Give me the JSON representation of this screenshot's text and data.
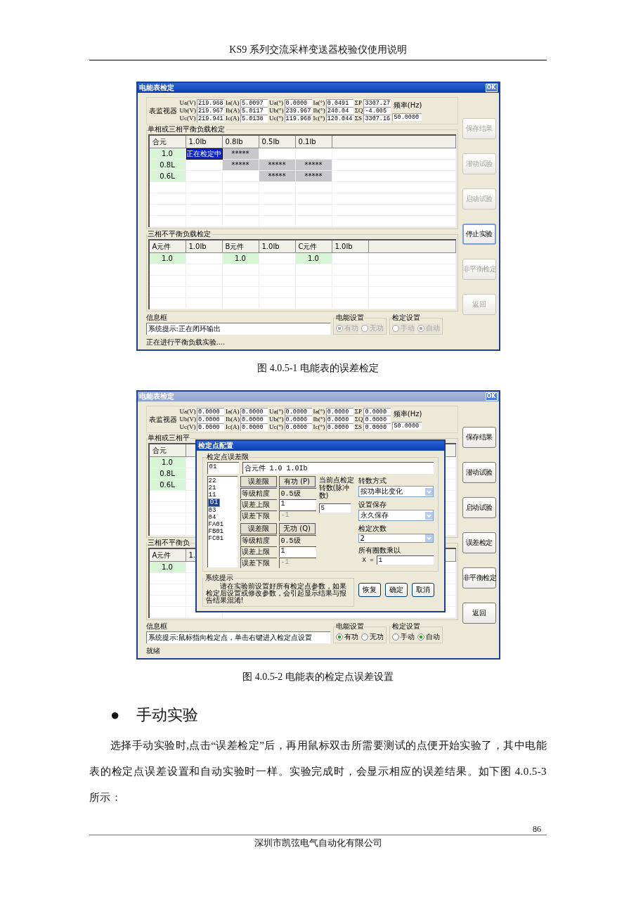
{
  "header": {
    "title": "KS9 系列交流采样变送器校验仪使用说明"
  },
  "figures": [
    {
      "window": {
        "title": "电能表检定",
        "active": true,
        "close_label": "OK",
        "monitor": {
          "label": "表监视器",
          "groups": [
            {
              "labels": [
                "Ua(V)",
                "Ub(V)",
                "Uc(V)"
              ],
              "values": [
                "219.968",
                "219.967",
                "219.941"
              ]
            },
            {
              "labels": [
                "Ia(A)",
                "Ib(A)",
                "Ic(A)"
              ],
              "values": [
                "5.0097",
                "5.0117",
                "5.0138"
              ]
            },
            {
              "labels": [
                "Ua(°)",
                "Ub(°)",
                "Uc(°)"
              ],
              "values": [
                "0.0000",
                "239.967",
                "119.968"
              ]
            },
            {
              "labels": [
                "Ia(°)",
                "Ib(°)",
                "Ic(°)"
              ],
              "values": [
                "0.0491",
                "240.04",
                "120.044"
              ]
            },
            {
              "labels": [
                "ΣP",
                "ΣQ",
                "ΣS"
              ],
              "values": [
                "3307.27",
                "-4.005",
                "3307.16"
              ]
            }
          ],
          "frequency": {
            "label": "频率(Hz)",
            "value": "50.0000"
          }
        },
        "balanced": {
          "title": "单相或三相平衡负载检定",
          "columns": [
            "合元",
            "1.0Ib",
            "0.8Ib",
            "0.5Ib",
            "0.1Ib"
          ],
          "rows": [
            {
              "cells": [
                {
                  "text": "1.0",
                  "kind": "label"
                },
                {
                  "text": "正在检定中",
                  "kind": "testing"
                },
                {
                  "text": "*****",
                  "kind": "queued"
                },
                {
                  "kind": "empty"
                },
                {
                  "kind": "empty"
                }
              ]
            },
            {
              "cells": [
                {
                  "text": "0.8L",
                  "kind": "label"
                },
                {
                  "kind": "empty"
                },
                {
                  "text": "*****",
                  "kind": "queued"
                },
                {
                  "text": "*****",
                  "kind": "queued"
                },
                {
                  "text": "*****",
                  "kind": "queued"
                }
              ]
            },
            {
              "cells": [
                {
                  "text": "0.6L",
                  "kind": "label"
                },
                {
                  "kind": "empty"
                },
                {
                  "kind": "empty"
                },
                {
                  "text": "*****",
                  "kind": "queued"
                },
                {
                  "text": "*****",
                  "kind": "queued"
                }
              ]
            }
          ]
        },
        "unbalanced": {
          "title": "三相不平衡负载检定",
          "columns": [
            "A元件",
            "1.0Ib",
            "B元件",
            "1.0Ib",
            "C元件",
            "1.0Ib"
          ],
          "rows": [
            {
              "cells": [
                {
                  "text": "1.0",
                  "kind": "label"
                },
                {
                  "kind": "empty"
                },
                {
                  "text": "1.0",
                  "kind": "label"
                },
                {
                  "kind": "empty"
                },
                {
                  "text": "1.0",
                  "kind": "label"
                },
                {
                  "kind": "empty"
                }
              ]
            }
          ]
        },
        "buttons": [
          {
            "label": "保存结果",
            "disabled": true,
            "focused": false
          },
          {
            "label": "潜动试验",
            "disabled": true,
            "focused": false
          },
          {
            "label": "启动试验",
            "disabled": true,
            "focused": false
          },
          {
            "label": "停止实验",
            "disabled": false,
            "focused": true
          },
          {
            "label": "非平衡检定",
            "disabled": true,
            "focused": false
          },
          {
            "label": "返回",
            "disabled": true,
            "focused": false
          }
        ],
        "info": {
          "label": "信息框",
          "message": "系统提示:正在闭环输出"
        },
        "energy": {
          "title": "电能设置",
          "disabled": true,
          "options": [
            {
              "label": "有功",
              "selected": true
            },
            {
              "label": "无功",
              "selected": false
            }
          ]
        },
        "mode": {
          "title": "检定设置",
          "disabled": true,
          "options": [
            {
              "label": "手动",
              "selected": false
            },
            {
              "label": "自动",
              "selected": true
            }
          ]
        },
        "status": "正在进行平衡负载实验...."
      },
      "caption": "图 4.0.5-1 电能表的误差检定"
    },
    {
      "window": {
        "title": "电能表检定",
        "active": false,
        "close_label": "OK",
        "monitor": {
          "label": "表监视器",
          "groups": [
            {
              "labels": [
                "Ua(V)",
                "Ub(V)",
                "Uc(V)"
              ],
              "values": [
                "0.0000",
                "0.0000",
                "0.0000"
              ]
            },
            {
              "labels": [
                "Ia(A)",
                "Ib(A)",
                "Ic(A)"
              ],
              "values": [
                "0.0000",
                "0.0000",
                "0.0000"
              ]
            },
            {
              "labels": [
                "Ua(°)",
                "Ub(°)",
                "Uc(°)"
              ],
              "values": [
                "0.0000",
                "0.0000",
                "0.0000"
              ]
            },
            {
              "labels": [
                "Ia(°)",
                "Ib(°)",
                "Ic(°)"
              ],
              "values": [
                "0.0000",
                "0.0000",
                "0.0000"
              ]
            },
            {
              "labels": [
                "ΣP",
                "ΣQ",
                "ΣS"
              ],
              "values": [
                "0.0000",
                "0.0000",
                "0.0000"
              ]
            }
          ],
          "frequency": {
            "label": "频率(Hz)",
            "value": "50.0000"
          }
        },
        "balanced": {
          "title": "单相或三相平",
          "columns": [
            "合元"
          ],
          "rows": [
            {
              "cells": [
                {
                  "text": "1.0",
                  "kind": "label"
                }
              ]
            },
            {
              "cells": [
                {
                  "text": "0.8L",
                  "kind": "label"
                }
              ]
            },
            {
              "cells": [
                {
                  "text": "0.6L",
                  "kind": "label"
                }
              ]
            }
          ]
        },
        "unbalanced": {
          "title": "三相不平衡负",
          "columns": [
            "A元件",
            "1."
          ],
          "rows": [
            {
              "cells": [
                {
                  "text": "1.0",
                  "kind": "label"
                }
              ]
            }
          ]
        },
        "buttons": [
          {
            "label": "保存结果",
            "disabled": false,
            "focused": false
          },
          {
            "label": "潜动试验",
            "disabled": false,
            "focused": false
          },
          {
            "label": "启动试验",
            "disabled": false,
            "focused": false
          },
          {
            "label": "误差检定",
            "disabled": false,
            "focused": false
          },
          {
            "label": "非平衡检定",
            "disabled": false,
            "focused": false
          },
          {
            "label": "返回",
            "disabled": false,
            "focused": false
          }
        ],
        "info": {
          "label": "信息框",
          "message": "系统提示:鼠标指向检定点，单击右键进入检定点设置"
        },
        "energy": {
          "title": "电能设置",
          "disabled": false,
          "options": [
            {
              "label": "有功",
              "selected": true
            },
            {
              "label": "无功",
              "selected": false
            }
          ]
        },
        "mode": {
          "title": "检定设置",
          "disabled": false,
          "options": [
            {
              "label": "手动",
              "selected": false
            },
            {
              "label": "自动",
              "selected": true
            }
          ]
        },
        "status": "就绪",
        "dialog": {
          "title": "检定点配置",
          "group_title": "检定点误差限",
          "code": "01",
          "description": "合元件 1.0 1.0Ib",
          "points": [
            {
              "label": "22",
              "selected": false
            },
            {
              "label": "21",
              "selected": false
            },
            {
              "label": "11",
              "selected": false
            },
            {
              "label": "01",
              "selected": true
            },
            {
              "label": "03",
              "selected": false
            },
            {
              "label": "04",
              "selected": false
            },
            {
              "label": "FA01",
              "selected": false
            },
            {
              "label": "FB01",
              "selected": false
            },
            {
              "label": "FC01",
              "selected": false
            }
          ],
          "limits": [
            {
              "header": "误差限",
              "type": "有功 (P)",
              "rows": [
                {
                  "label": "等级精度",
                  "value": "0.5级",
                  "kind": "readonly"
                },
                {
                  "label": "误差上限",
                  "value": "1",
                  "kind": "input"
                },
                {
                  "label": "误差下限",
                  "value": "-1",
                  "kind": "disabled"
                }
              ]
            },
            {
              "header": "误差限",
              "type": "无功 (Q)",
              "rows": [
                {
                  "label": "等级精度",
                  "value": "0.5级",
                  "kind": "readonly"
                },
                {
                  "label": "误差上限",
                  "value": "1",
                  "kind": "input"
                },
                {
                  "label": "误差下限",
                  "value": "-1",
                  "kind": "disabled"
                }
              ]
            }
          ],
          "pulses": {
            "label": "当前点检定转数(脉冲数)",
            "value": "5"
          },
          "settings": [
            {
              "label": "转数方式",
              "kind": "select",
              "value": "按功率比变化"
            },
            {
              "label": "设置保存",
              "kind": "select",
              "value": "永久保存"
            },
            {
              "label": "检定次数",
              "kind": "select",
              "value": "2"
            },
            {
              "label": "所有圈数乘以",
              "kind": "multiplier",
              "prefix": "X =",
              "value": "1"
            }
          ],
          "hint": {
            "title": "系统提示",
            "text": "请在实验前设置好所有检定点参数，如果检定后设置或修改参数，会引起显示结果与报告结果混淆!"
          },
          "buttons": [
            "恢复",
            "确定",
            "取消"
          ]
        }
      },
      "caption": "图 4.0.5-2 电能表的检定点误差设置"
    }
  ],
  "section": {
    "bullet": "●",
    "heading": "手动实验",
    "paragraph": "选择手动实验时,点击“误差检定”后，再用鼠标双击所需要测试的点便开始实验了，其中电能表的检定点误差设置和自动实验时一样。实验完成时，会显示相应的误差结果。如下图 4.0.5-3 所示："
  },
  "footer": {
    "page_number": "86",
    "company": "深圳市凯弦电气自动化有限公司"
  }
}
